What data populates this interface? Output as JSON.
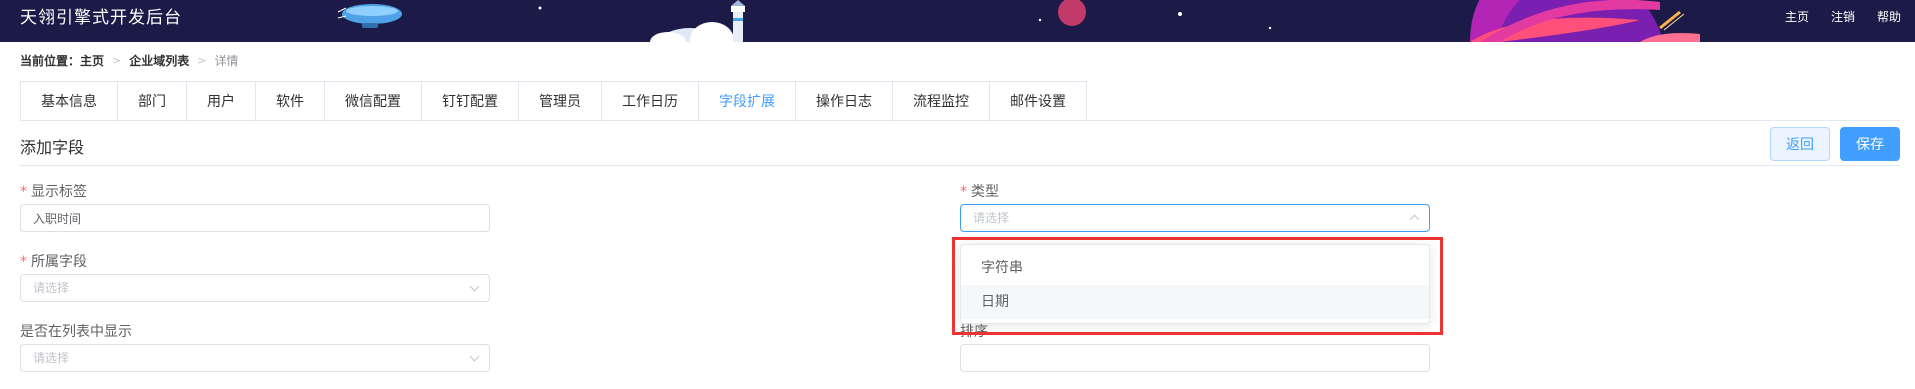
{
  "header": {
    "title": "天翎引擎式开发后台",
    "nav": [
      "主页",
      "注销",
      "帮助"
    ],
    "colors": {
      "background": "#1c1a47",
      "accent": "#409eff"
    }
  },
  "breadcrumb": {
    "label": "当前位置：",
    "items": [
      "主页",
      "企业域列表",
      "详情"
    ]
  },
  "tabs": [
    {
      "label": "基本信息",
      "active": false
    },
    {
      "label": "部门",
      "active": false
    },
    {
      "label": "用户",
      "active": false
    },
    {
      "label": "软件",
      "active": false
    },
    {
      "label": "微信配置",
      "active": false
    },
    {
      "label": "钉钉配置",
      "active": false
    },
    {
      "label": "管理员",
      "active": false
    },
    {
      "label": "工作日历",
      "active": false
    },
    {
      "label": "字段扩展",
      "active": true
    },
    {
      "label": "操作日志",
      "active": false
    },
    {
      "label": "流程监控",
      "active": false
    },
    {
      "label": "邮件设置",
      "active": false
    }
  ],
  "section": {
    "title": "添加字段",
    "back_label": "返回",
    "save_label": "保存"
  },
  "form": {
    "display_label": {
      "label": "显示标签",
      "required": "*",
      "value": "入职时间"
    },
    "field": {
      "label": "所属字段",
      "required": "*",
      "placeholder": "请选择"
    },
    "show_in_list": {
      "label": "是否在列表中显示",
      "placeholder": "请选择"
    },
    "type": {
      "label": "类型",
      "required": "*",
      "placeholder": "请选择"
    },
    "sort": {
      "label": "排序",
      "value": ""
    }
  },
  "dropdown": {
    "options": [
      "字符串",
      "日期"
    ],
    "hovered": "日期"
  }
}
